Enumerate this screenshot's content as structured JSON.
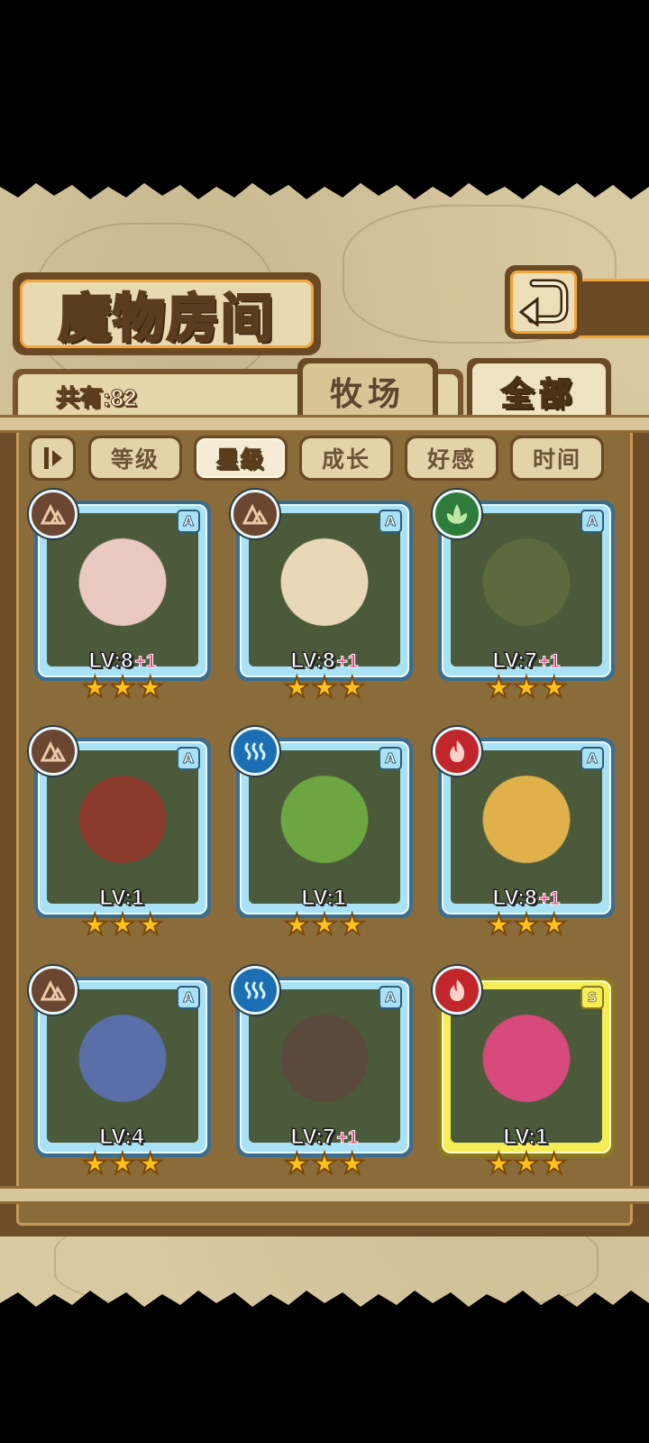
{
  "header": {
    "title": "魔物房间"
  },
  "summary": {
    "count_text": "共有:82"
  },
  "tabs": [
    {
      "label": "牧场",
      "active": false
    },
    {
      "label": "全部",
      "active": true
    }
  ],
  "sort": {
    "options": [
      {
        "label": "等级",
        "active": false
      },
      {
        "label": "星级",
        "active": true
      },
      {
        "label": "成长",
        "active": false
      },
      {
        "label": "好感",
        "active": false
      },
      {
        "label": "时间",
        "active": false
      }
    ]
  },
  "cards": [
    {
      "element": "earth-icon",
      "rank": "A",
      "level": "LV:8",
      "bonus": "+1",
      "stars": 3,
      "color": "#e9c9c0"
    },
    {
      "element": "earth-icon",
      "rank": "A",
      "level": "LV:8",
      "bonus": "+1",
      "stars": 3,
      "color": "#e8d8b8"
    },
    {
      "element": "nature-icon",
      "rank": "A",
      "level": "LV:7",
      "bonus": "+1",
      "stars": 3,
      "color": "#5c6a3e"
    },
    {
      "element": "earth-icon",
      "rank": "A",
      "level": "LV:1",
      "bonus": "",
      "stars": 3,
      "color": "#8a3b2c"
    },
    {
      "element": "water-icon",
      "rank": "A",
      "level": "LV:1",
      "bonus": "",
      "stars": 3,
      "color": "#6da640"
    },
    {
      "element": "fire-icon",
      "rank": "A",
      "level": "LV:8",
      "bonus": "+1",
      "stars": 3,
      "color": "#e0b04a"
    },
    {
      "element": "earth-icon",
      "rank": "A",
      "level": "LV:4",
      "bonus": "",
      "stars": 3,
      "color": "#5a6ea8"
    },
    {
      "element": "water-icon",
      "rank": "A",
      "level": "LV:7",
      "bonus": "+1",
      "stars": 3,
      "color": "#5a4a3c"
    },
    {
      "element": "fire-icon",
      "rank": "S",
      "level": "LV:1",
      "bonus": "",
      "stars": 3,
      "color": "#d64a7c"
    }
  ]
}
